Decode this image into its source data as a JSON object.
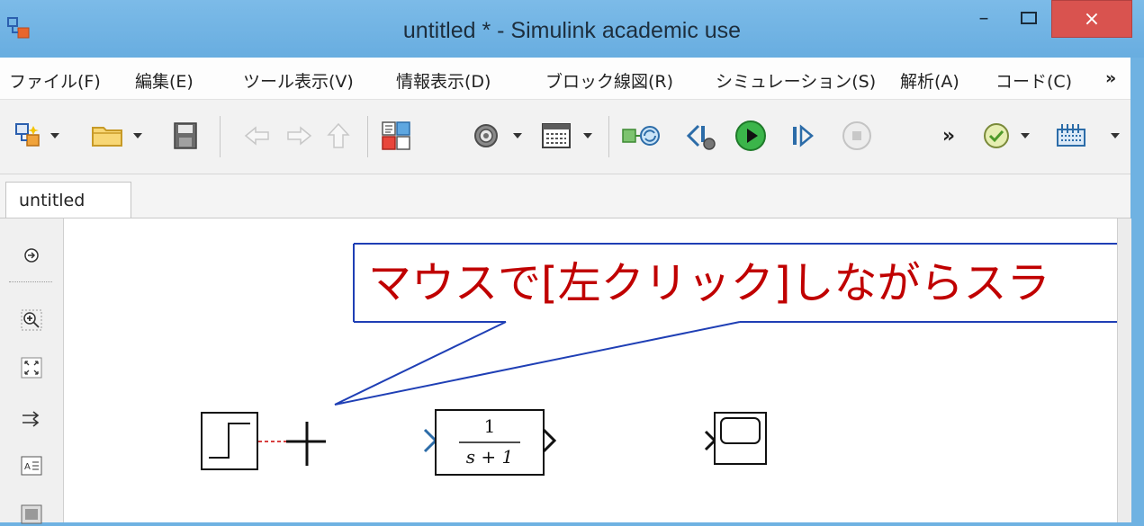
{
  "window": {
    "title": "untitled * - Simulink academic use"
  },
  "window_controls": {
    "minimize": "–",
    "close": "×"
  },
  "menu": {
    "items": [
      "ファイル(F)",
      "編集(E)",
      "ツール表示(V)",
      "情報表示(D)",
      "ブロック線図(R)",
      "シミュレーション(S)",
      "解析(A)",
      "コード(C)"
    ],
    "overflow": "»"
  },
  "toolbar": {
    "overflow": "»"
  },
  "tabs": [
    {
      "label": "untitled"
    }
  ],
  "annotation": {
    "text": "マウスで[左クリック]しながらスラ"
  },
  "blocks": {
    "transfer_fcn": {
      "numerator": "1",
      "denominator": "s + 1"
    }
  },
  "colors": {
    "titlebar": "#6fb2e2",
    "close_button": "#d9534f",
    "annotation_text": "#c00000",
    "annotation_border": "#1f3fb5",
    "signal_line": "#cc0000"
  }
}
